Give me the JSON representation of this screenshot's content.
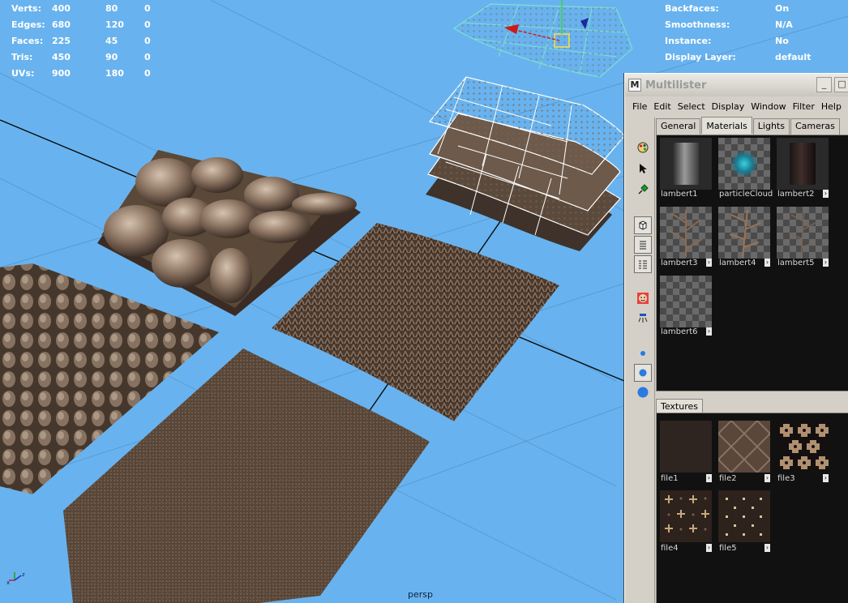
{
  "hud": {
    "stats": [
      {
        "label": "Verts:",
        "v1": "400",
        "v2": "80",
        "v3": "0"
      },
      {
        "label": "Edges:",
        "v1": "680",
        "v2": "120",
        "v3": "0"
      },
      {
        "label": "Faces:",
        "v1": "225",
        "v2": "45",
        "v3": "0"
      },
      {
        "label": "Tris:",
        "v1": "450",
        "v2": "90",
        "v3": "0"
      },
      {
        "label": "UVs:",
        "v1": "900",
        "v2": "180",
        "v3": "0"
      }
    ],
    "attrs": [
      {
        "label": "Backfaces:",
        "value": "On"
      },
      {
        "label": "Smoothness:",
        "value": "N/A"
      },
      {
        "label": "Instance:",
        "value": "No"
      },
      {
        "label": "Display Layer:",
        "value": "default"
      }
    ],
    "camera": "persp"
  },
  "multilister": {
    "title": "Multilister",
    "icon_letter": "M",
    "window_buttons": {
      "minimize": "_",
      "maximize": "□"
    },
    "menu": [
      "File",
      "Edit",
      "Select",
      "Display",
      "Window",
      "Filter",
      "Help"
    ],
    "tabs": [
      "General",
      "Materials",
      "Lights",
      "Cameras"
    ],
    "active_tab": "Materials",
    "materials": [
      {
        "name": "lambert1",
        "style": "grey-cylinder"
      },
      {
        "name": "particleCloud",
        "style": "cloud"
      },
      {
        "name": "lambert2",
        "style": "dark-cylinder"
      },
      {
        "name": "lambert3",
        "style": "check-branch"
      },
      {
        "name": "lambert4",
        "style": "check-branch"
      },
      {
        "name": "lambert5",
        "style": "check-branch"
      },
      {
        "name": "lambert6",
        "style": "check"
      }
    ],
    "texture_tabs": [
      "Textures"
    ],
    "textures": [
      {
        "name": "file1",
        "style": "plain-dark"
      },
      {
        "name": "file2",
        "style": "diamond"
      },
      {
        "name": "file3",
        "style": "cross-dots"
      },
      {
        "name": "file4",
        "style": "plus"
      },
      {
        "name": "file5",
        "style": "dots"
      }
    ],
    "tools": [
      "palette-icon",
      "arrow-icon",
      "pin-icon",
      "cube-icon",
      "list-icon",
      "grid-list-icon",
      "face-icon",
      "light-icon",
      "sphere-small-icon",
      "sphere-medium-icon",
      "sphere-large-icon"
    ]
  },
  "colors": {
    "viewport": "#68b3ef",
    "panel": "#111111",
    "window": "#d4d0c8"
  }
}
